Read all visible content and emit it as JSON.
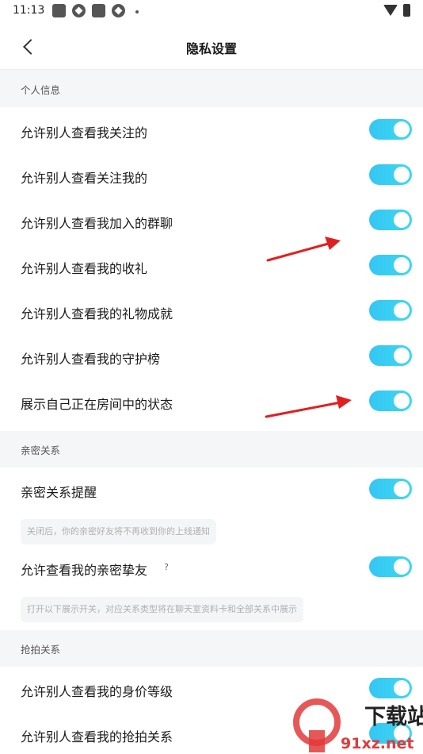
{
  "status_bar": {
    "time": "11:13"
  },
  "header": {
    "title": "隐私设置"
  },
  "sections": [
    {
      "title": "个人信息",
      "items": [
        {
          "label": "允许别人查看我关注的",
          "on": true
        },
        {
          "label": "允许别人查看关注我的",
          "on": true
        },
        {
          "label": "允许别人查看我加入的群聊",
          "on": true
        },
        {
          "label": "允许别人查看我的收礼",
          "on": true
        },
        {
          "label": "允许别人查看我的礼物成就",
          "on": true
        },
        {
          "label": "允许别人查看我的守护榜",
          "on": true
        },
        {
          "label": "展示自己正在房间中的状态",
          "on": true
        }
      ]
    },
    {
      "title": "亲密关系",
      "items": [
        {
          "label": "亲密关系提醒",
          "on": true,
          "hint": "关闭后，你的亲密好友将不再收到你的上线通知"
        },
        {
          "label": "允许查看我的亲密挚友",
          "on": true,
          "help": "?",
          "hint": "打开以下展示开关，对应关系类型将在聊天室资料卡和全部关系中展示"
        }
      ]
    },
    {
      "title": "抢拍关系",
      "items": [
        {
          "label": "允许别人查看我的身价等级",
          "on": true
        },
        {
          "label": "允许别人查看我的抢拍关系",
          "on": true
        }
      ]
    }
  ],
  "watermark": {
    "text": "下载站",
    "url_text": "91xz.net"
  },
  "colors": {
    "toggle_on": "#3dd0f0",
    "arrow": "#e02020"
  }
}
